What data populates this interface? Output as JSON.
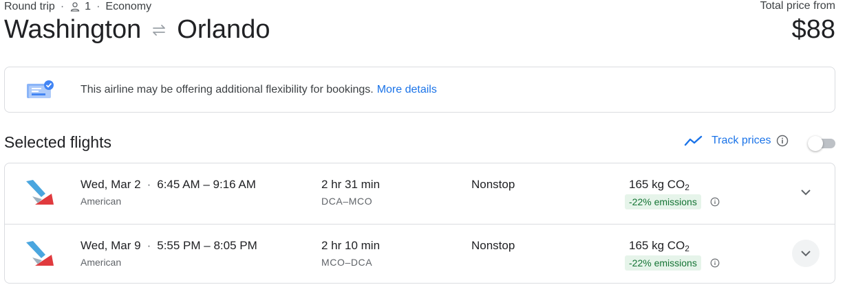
{
  "header": {
    "trip_type": "Round trip",
    "passengers": "1",
    "cabin": "Economy",
    "origin": "Washington",
    "destination": "Orlando",
    "total_price_label": "Total price from",
    "total_price": "$88"
  },
  "banner": {
    "text": "This airline may be offering additional flexibility for bookings.",
    "link": "More details"
  },
  "selected": {
    "title": "Selected flights",
    "track_label": "Track prices",
    "track_enabled": false
  },
  "flights": [
    {
      "date": "Wed, Mar 2",
      "times": "6:45 AM – 9:16 AM",
      "airline": "American",
      "duration": "2 hr 31 min",
      "airports": "DCA–MCO",
      "stops": "Nonstop",
      "co2": "165 kg CO",
      "co2_sub": "2",
      "emissions": "-22% emissions"
    },
    {
      "date": "Wed, Mar 9",
      "times": "5:55 PM – 8:05 PM",
      "airline": "American",
      "duration": "2 hr 10 min",
      "airports": "MCO–DCA",
      "stops": "Nonstop",
      "co2": "165 kg CO",
      "co2_sub": "2",
      "emissions": "-22% emissions"
    }
  ],
  "icons": {
    "person": "person-icon",
    "swap": "swap-arrows-icon",
    "banner": "flexible-booking-icon",
    "trend": "trending-icon",
    "info": "info-icon",
    "chevron": "chevron-down-icon",
    "logo": "american-airlines-logo"
  },
  "colors": {
    "accent": "#1a73e8",
    "emissions_text": "#137333",
    "emissions_bg": "#e6f4ea",
    "logo_red": "#e03a3e",
    "logo_blue": "#4aa6df"
  }
}
